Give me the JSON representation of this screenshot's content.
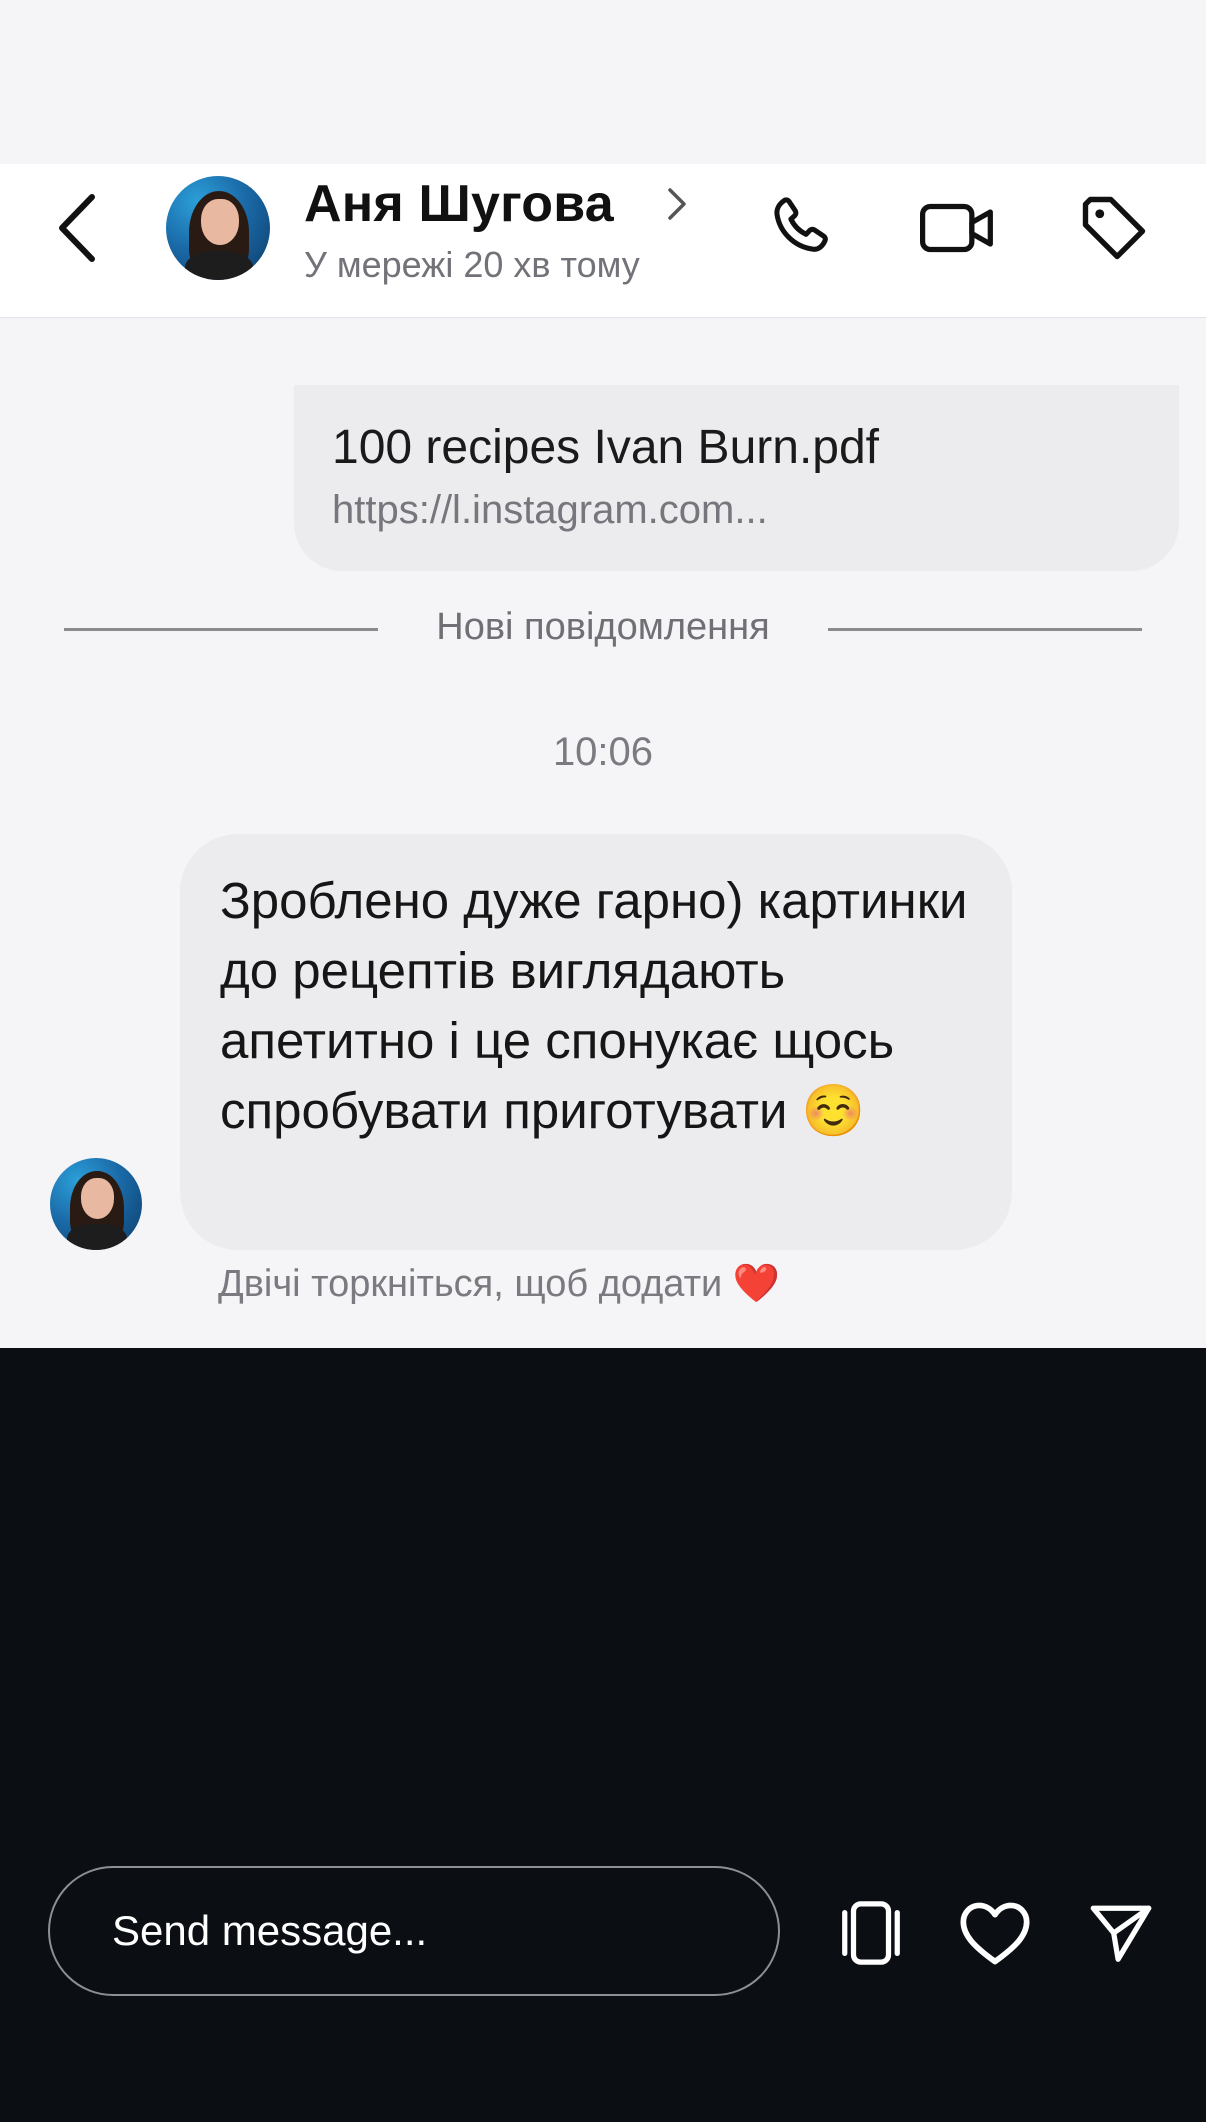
{
  "header": {
    "contact_name": "Аня Шугова",
    "status": "У мережі 20 хв тому",
    "icons": [
      "back-icon",
      "chevron-right-icon",
      "phone-icon",
      "video-camera-icon",
      "tag-icon"
    ]
  },
  "messages": {
    "file": {
      "name": "100 recipes Ivan Burn.pdf",
      "url": "https://l.instagram.com..."
    },
    "new_messages_divider": "Нові повідомлення",
    "timestamp": "10:06",
    "incoming_text": "Зроблено дуже гарно) картинки до рецептів виглядають апетитно і це спонукає щось спробувати приготувати ☺️",
    "reaction_hint": "Двічі торкніться, щоб додати ❤️"
  },
  "composer": {
    "placeholder": "Send message...",
    "icons": [
      "sticker-icon",
      "heart-icon",
      "send-icon"
    ]
  },
  "colors": {
    "background": "#f5f5f7",
    "bubble": "#ececef",
    "header": "#ffffff",
    "bottom_bar": "#0b0f14"
  }
}
